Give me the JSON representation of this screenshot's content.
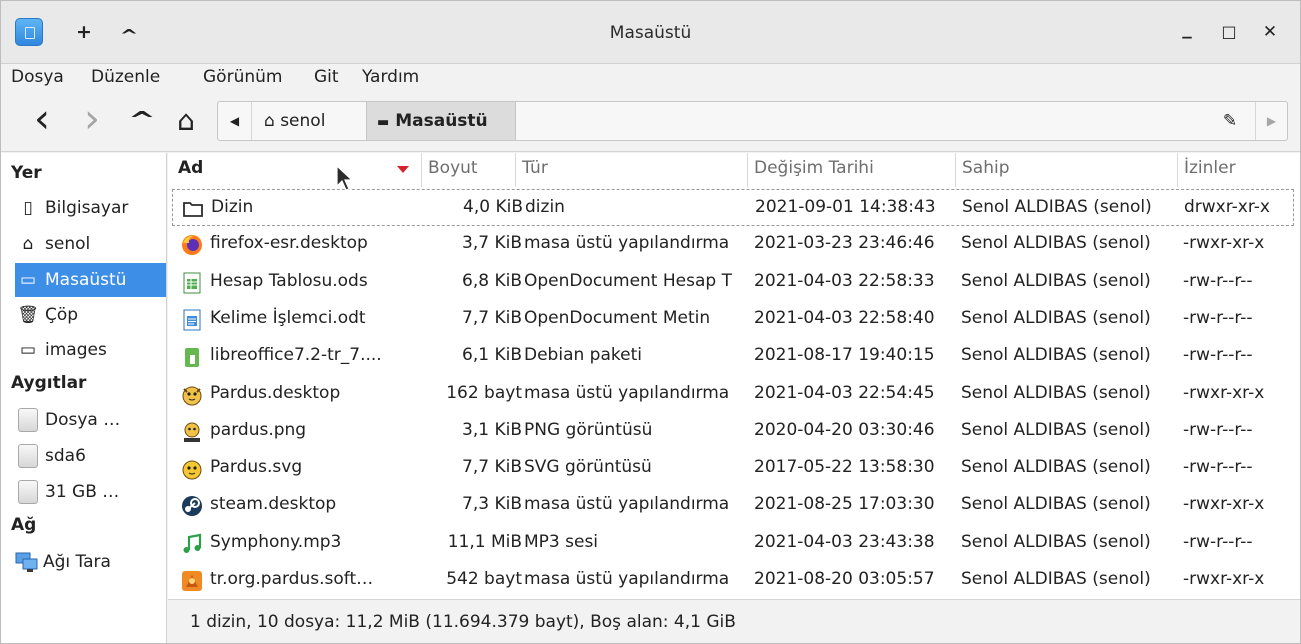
{
  "window": {
    "title": "Masaüstü",
    "pin_glyph": "+",
    "shade_glyph": "^",
    "min_glyph": "_",
    "max_glyph": "□",
    "close_glyph": "✕"
  },
  "menubar": {
    "items": [
      "Dosya",
      "Düzenle",
      "Görünüm",
      "Git",
      "Yardım"
    ]
  },
  "toolbar": {
    "back_glyph": "‹",
    "forward_glyph": "›",
    "up_glyph": "^",
    "home_glyph": "⌂",
    "crumbs": [
      {
        "icon": "⌂",
        "label": "senol"
      },
      {
        "icon": "▬",
        "label": "Masaüstü"
      }
    ],
    "edit_glyph": "✎"
  },
  "sidebar": {
    "sections": [
      {
        "header": "Yer",
        "items": [
          {
            "icon": "computer-icon",
            "glyph": "▯",
            "label": "Bilgisayar",
            "selected": false
          },
          {
            "icon": "home-icon",
            "glyph": "⌂",
            "label": "senol",
            "selected": false
          },
          {
            "icon": "desktop-icon",
            "glyph": "▭",
            "label": "Masaüstü",
            "selected": true
          },
          {
            "icon": "trash-icon",
            "glyph": "🗑",
            "label": "Çöp",
            "selected": false
          },
          {
            "icon": "folder-icon",
            "glyph": "▭",
            "label": "images",
            "selected": false
          }
        ]
      },
      {
        "header": "Aygıtlar",
        "items": [
          {
            "icon": "drive-icon",
            "label": "Dosya …"
          },
          {
            "icon": "drive-icon",
            "label": "sda6"
          },
          {
            "icon": "drive-icon",
            "label": "31 GB …"
          }
        ]
      },
      {
        "header": "Ağ",
        "items": [
          {
            "icon": "network-icon",
            "label": "Ağı Tara"
          }
        ]
      }
    ]
  },
  "columns": [
    "Ad",
    "Boyut",
    "Tür",
    "Değişim Tarihi",
    "Sahip",
    "İzinler"
  ],
  "files": [
    {
      "icon": "folder-icon",
      "name": "Dizin",
      "size": "4,0 KiB",
      "type": "dizin",
      "date": "2021-09-01 14:38:43",
      "owner": "Senol ALDIBAS (senol)",
      "perm": "drwxr-xr-x"
    },
    {
      "icon": "firefox-icon",
      "name": "firefox-esr.desktop",
      "size": "3,7 KiB",
      "type": "masa üstü yapılandırma",
      "date": "2021-03-23 23:46:46",
      "owner": "Senol ALDIBAS (senol)",
      "perm": "-rwxr-xr-x"
    },
    {
      "icon": "spreadsheet-icon",
      "name": "Hesap Tablosu.ods",
      "size": "6,8 KiB",
      "type": "OpenDocument Hesap T",
      "date": "2021-04-03 22:58:33",
      "owner": "Senol ALDIBAS (senol)",
      "perm": "-rw-r--r--"
    },
    {
      "icon": "document-icon",
      "name": "Kelime İşlemci.odt",
      "size": "7,7 KiB",
      "type": "OpenDocument Metin",
      "date": "2021-04-03 22:58:40",
      "owner": "Senol ALDIBAS (senol)",
      "perm": "-rw-r--r--"
    },
    {
      "icon": "package-icon",
      "name": "libreoffice7.2-tr_7....",
      "size": "6,1 KiB",
      "type": "Debian paketi",
      "date": "2021-08-17 19:40:15",
      "owner": "Senol ALDIBAS (senol)",
      "perm": "-rw-r--r--"
    },
    {
      "icon": "pardus-icon",
      "name": "Pardus.desktop",
      "size": "162 bayt",
      "type": "masa üstü yapılandırma",
      "date": "2021-04-03 22:54:45",
      "owner": "Senol ALDIBAS (senol)",
      "perm": "-rwxr-xr-x"
    },
    {
      "icon": "pardus-image-icon",
      "name": "pardus.png",
      "size": "3,1 KiB",
      "type": "PNG görüntüsü",
      "date": "2020-04-20 03:30:46",
      "owner": "Senol ALDIBAS (senol)",
      "perm": "-rw-r--r--"
    },
    {
      "icon": "pardus-svg-icon",
      "name": "Pardus.svg",
      "size": "7,7 KiB",
      "type": "SVG görüntüsü",
      "date": "2017-05-22 13:58:30",
      "owner": "Senol ALDIBAS (senol)",
      "perm": "-rw-r--r--"
    },
    {
      "icon": "steam-icon",
      "name": "steam.desktop",
      "size": "7,3 KiB",
      "type": "masa üstü yapılandırma",
      "date": "2021-08-25 17:03:30",
      "owner": "Senol ALDIBAS (senol)",
      "perm": "-rwxr-xr-x"
    },
    {
      "icon": "music-icon",
      "name": "Symphony.mp3",
      "size": "11,1 MiB",
      "type": "MP3 sesi",
      "date": "2021-04-03 23:43:38",
      "owner": "Senol ALDIBAS (senol)",
      "perm": "-rw-r--r--"
    },
    {
      "icon": "app-orange-icon",
      "name": "tr.org.pardus.soft…",
      "size": "542 bayt",
      "type": "masa üstü yapılandırma",
      "date": "2021-08-20 03:05:57",
      "owner": "Senol ALDIBAS (senol)",
      "perm": "-rwxr-xr-x"
    }
  ],
  "status": "1 dizin, 10 dosya: 11,2 MiB (11.694.379 bayt), Boş alan: 4,1 GiB",
  "colors": {
    "accent": "#3d8ee6",
    "sort_arrow": "#d6242b"
  }
}
